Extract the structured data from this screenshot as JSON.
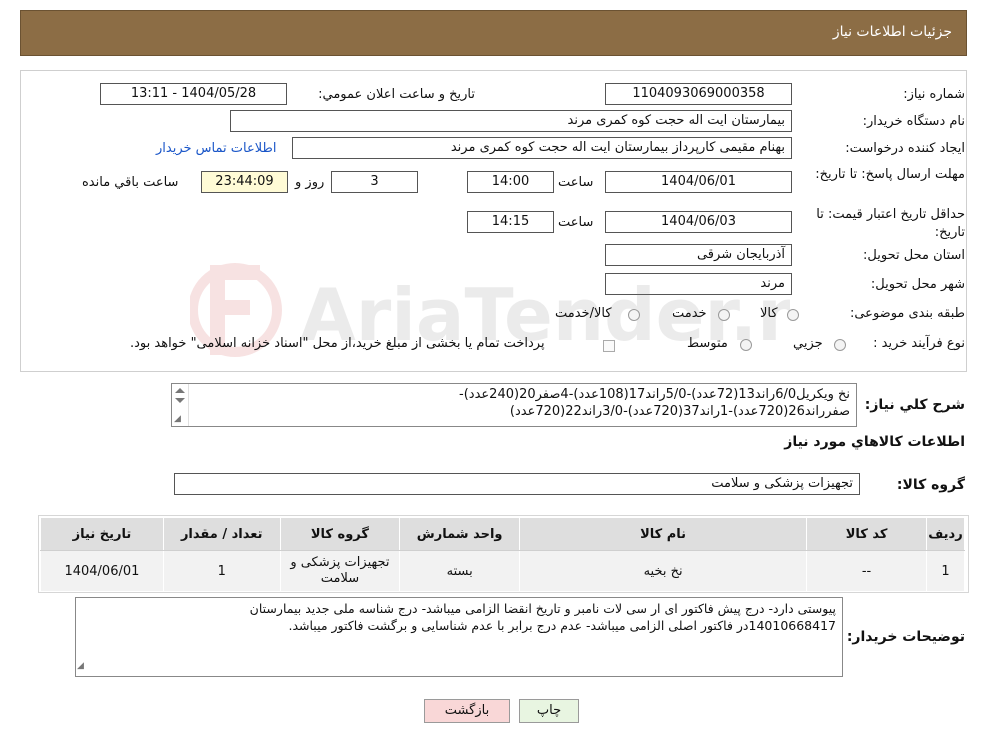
{
  "header": {
    "title": "جزئیات اطلاعات نیاز"
  },
  "form": {
    "need_number_label": "شماره نیاز:",
    "need_number": "1104093069000358",
    "announce_label": "تاريخ و ساعت اعلان عمومي:",
    "announce_value": "1404/05/28 - 13:11",
    "buyer_org_label": "نام دستگاه خريدار:",
    "buyer_org": "بیمارستان ایت اله حجت کوه کمری مرند",
    "creator_label": "ايجاد کننده درخواست:",
    "creator": "بهنام مقیمی کارپرداز بیمارستان ایت اله حجت کوه کمری مرند",
    "contact_link": "اطلاعات تماس خريدار",
    "reply_deadline_label": "مهلت ارسال پاسخ: تا تاريخ:",
    "reply_date": "1404/06/01",
    "time_label": "ساعت",
    "reply_time": "14:00",
    "days_value": "3",
    "days_label": "روز و",
    "remaining_time": "23:44:09",
    "remaining_label": "ساعت باقي مانده",
    "price_validity_label": "حداقل تاريخ اعتبار قيمت: تا تاريخ:",
    "validity_date": "1404/06/03",
    "validity_time": "14:15",
    "province_label": "استان محل تحويل:",
    "province": "آذربایجان شرقی",
    "city_label": "شهر محل تحويل:",
    "city": "مرند",
    "category_label": "طبقه بندی موضوعی:",
    "category_options": [
      "کالا",
      "خدمت",
      "کالا/خدمت"
    ],
    "process_label": "نوع فرآيند خريد :",
    "process_options": [
      "جزيي",
      "متوسط"
    ],
    "process_note": "پرداخت تمام يا بخشی از مبلغ خريد،از محل \"اسناد خزانه اسلامی\" خواهد بود."
  },
  "watermark": {
    "text": "AriaTender.neT"
  },
  "summary": {
    "label": "شرح كلي نياز:",
    "line1": "نخ ویکریل6/0راند13(72عدد)-5/0راند17(108عدد)-4صفر20(240عدد)-",
    "line2": "صفرراند26(720عدد)-1راند37(720عدد)-3/0راند22(720عدد)"
  },
  "goods_section": {
    "title": "اطلاعات كالاهاي مورد نياز",
    "group_label": "گروه كالا:",
    "group_value": "تجهیزات پزشکی و سلامت"
  },
  "table": {
    "headers": [
      "رديف",
      "كد كالا",
      "نام كالا",
      "واحد شمارش",
      "گروه كالا",
      "تعداد / مقدار",
      "تاريخ نياز"
    ],
    "rows": [
      [
        "1",
        "--",
        "نخ بخیه",
        "بسته",
        "تجهیزات پزشکی و سلامت",
        "1",
        "1404/06/01"
      ]
    ]
  },
  "buyer_notes": {
    "label": "توضيحات خريدار:",
    "line1": "پیوستی دارد- درج پیش فاکتور ای ار سی لات نامبر و تاریخ انقضا الزامی میباشد- درج شناسه ملی  جدید بیمارستان",
    "line2": "14010668417در فاکتور اصلی الزامی میباشد- عدم درج برابر با عدم شناسایی و برگشت فاکتور میباشد."
  },
  "buttons": {
    "print": "چاپ",
    "back": "بازگشت"
  },
  "colors": {
    "header_bg": "#8c6d45",
    "back_button_bg": "#f9d7d7",
    "print_button_bg": "#e8f5e1",
    "remaining_bg": "#fffbd6",
    "link": "#1a56c8"
  }
}
